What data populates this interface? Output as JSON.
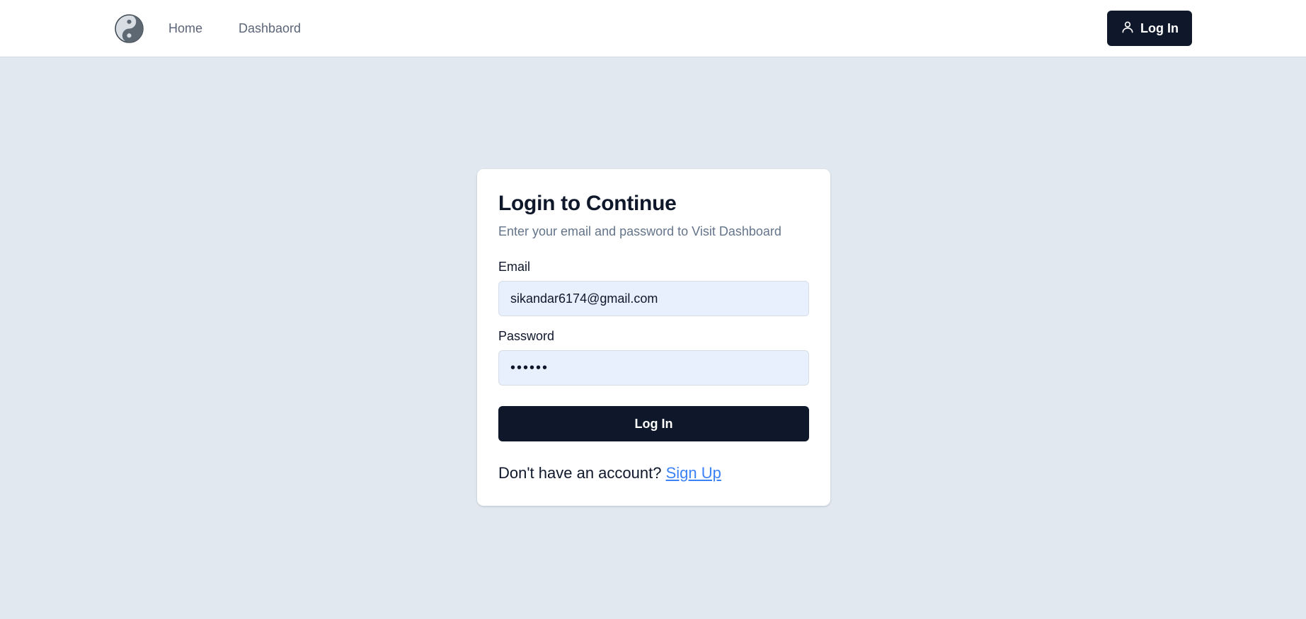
{
  "nav": {
    "logo_icon": "yin-yang-icon",
    "links": [
      {
        "label": "Home"
      },
      {
        "label": "Dashbaord"
      }
    ],
    "login_button": {
      "label": "Log In",
      "icon": "user-icon"
    }
  },
  "login_card": {
    "title": "Login to Continue",
    "subtitle": "Enter your email and password to Visit Dashboard",
    "email": {
      "label": "Email",
      "value": "sikandar6174@gmail.com"
    },
    "password": {
      "label": "Password",
      "value": "••••••"
    },
    "submit_label": "Log In",
    "signup_prompt": "Don't have an account?",
    "signup_link": "Sign Up"
  },
  "colors": {
    "page_bg": "#e1e8f0",
    "primary": "#0f172a",
    "input_bg": "#e8f0fe",
    "link": "#3b82f6",
    "muted_text": "#64748b"
  }
}
